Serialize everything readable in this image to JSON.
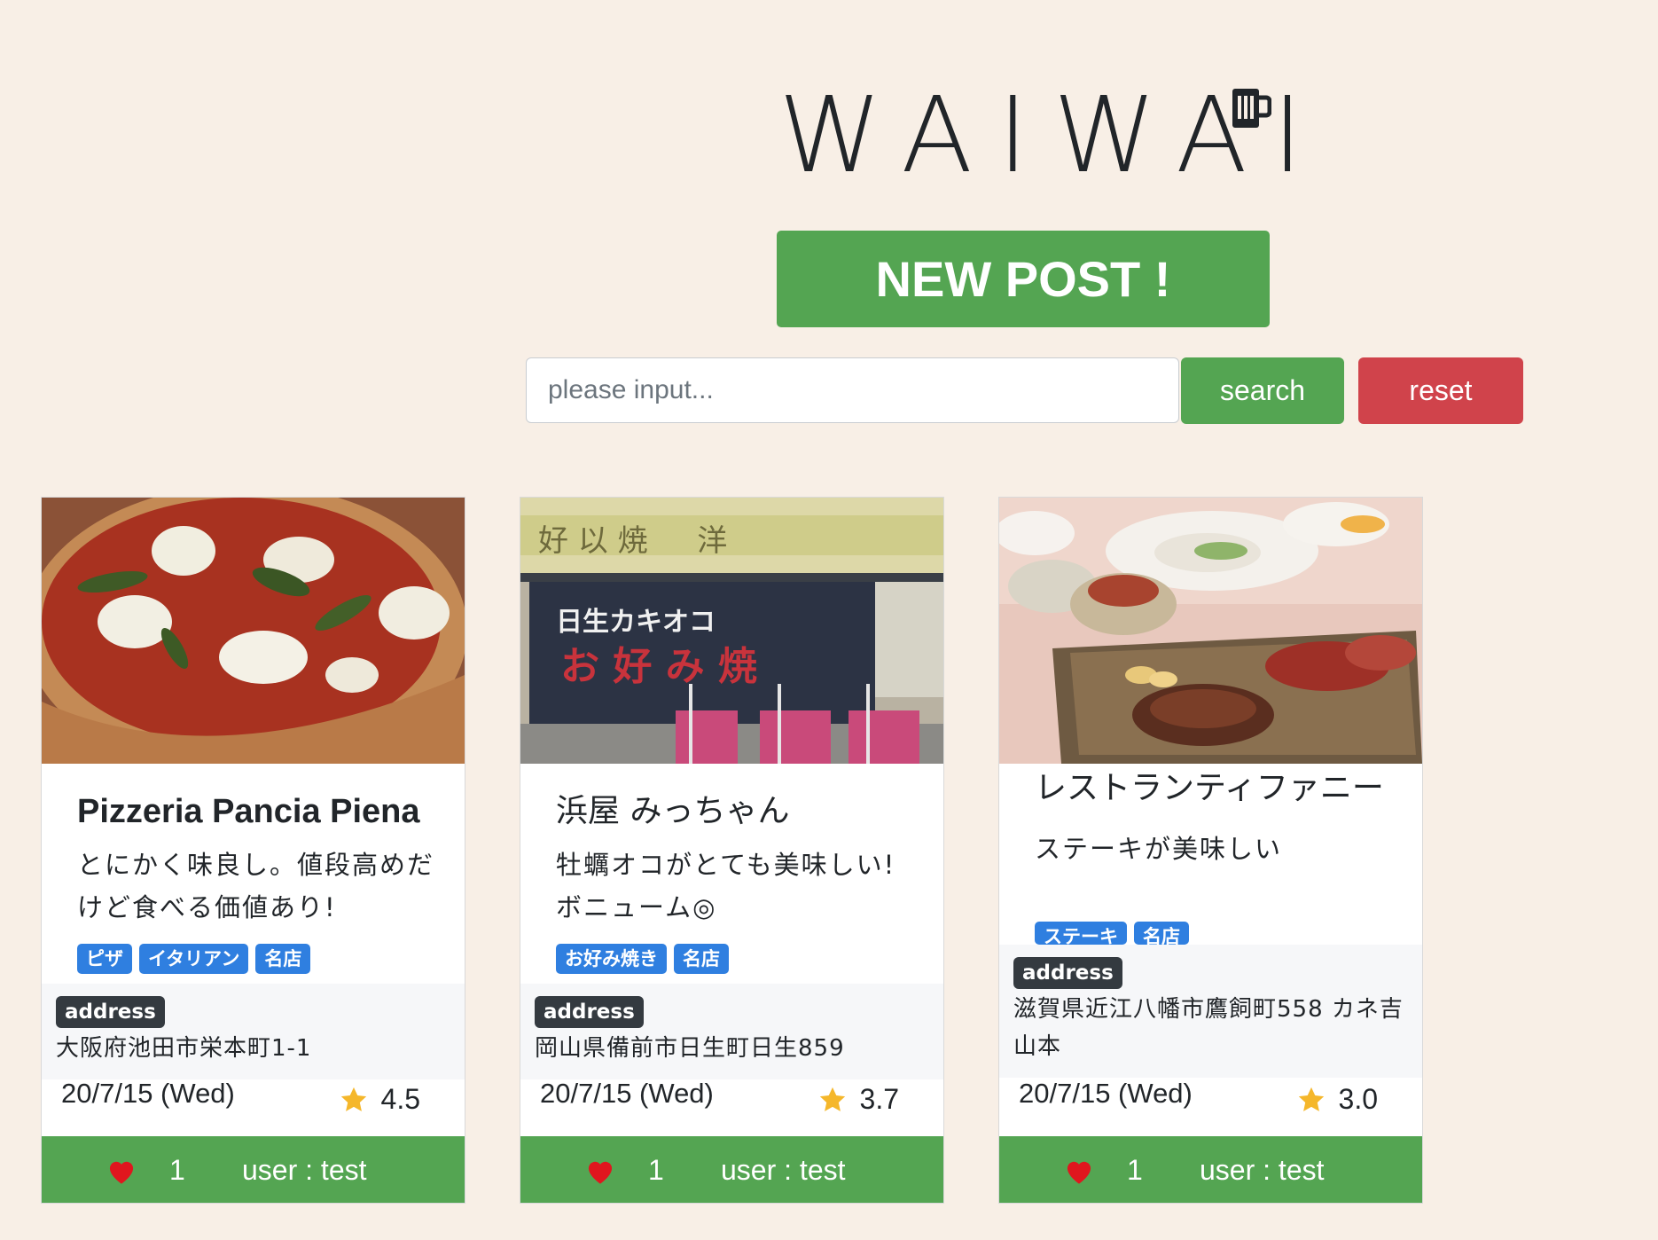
{
  "header": {
    "logo_text": "WAIWAI",
    "logo_icon": "beer-mug-icon",
    "new_post_label": "NEW POST !"
  },
  "search": {
    "placeholder": "please input...",
    "value": "",
    "search_label": "search",
    "reset_label": "reset"
  },
  "colors": {
    "background": "#f8efe6",
    "accent_green": "#54a552",
    "reset_red": "#d0434b",
    "tag_blue": "#2f7fe0",
    "badge_dark": "#343a40",
    "star": "#f5b72b",
    "heart": "#e0161e"
  },
  "posts": [
    {
      "image": "pizza-photo",
      "title": "Pizzeria Pancia Piena",
      "description": "とにかく味良し。値段高めだけど食べる価値あり!",
      "tags": [
        "ピザ",
        "イタリアン",
        "名店"
      ],
      "address_label": "address",
      "address": "大阪府池田市栄本町1-1",
      "date": "20/7/15 (Wed)",
      "rating": "4.5",
      "likes": "1",
      "user": "user : test"
    },
    {
      "image": "okonomiyaki-shop-photo",
      "title": "浜屋 みっちゃん",
      "description": "牡蠣オコがとても美味しい!　ボニューム◎",
      "tags": [
        "お好み焼き",
        "名店"
      ],
      "address_label": "address",
      "address": "岡山県備前市日生町日生859",
      "date": "20/7/15 (Wed)",
      "rating": "3.7",
      "likes": "1",
      "user": "user : test"
    },
    {
      "image": "steak-dinner-photo",
      "title": "レストランティファニー",
      "description": "ステーキが美味しい",
      "tags": [
        "ステーキ",
        "名店"
      ],
      "address_label": "address",
      "address": "滋賀県近江八幡市鷹飼町558 カネ吉山本",
      "date": "20/7/15 (Wed)",
      "rating": "3.0",
      "likes": "1",
      "user": "user : test"
    }
  ]
}
